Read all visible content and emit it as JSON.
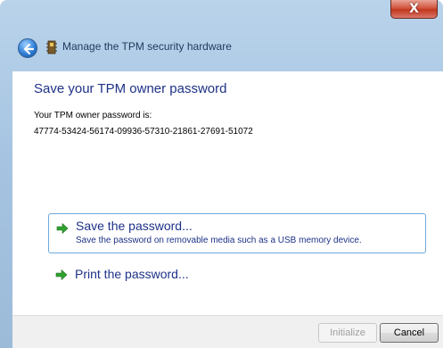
{
  "window": {
    "title": "Manage the TPM security hardware",
    "close_glyph": "X"
  },
  "page": {
    "heading": "Save your TPM owner password",
    "password_label": "Your TPM owner password is:",
    "password_value": "47774-53424-56174-09936-57310-21861-27691-51072"
  },
  "options": [
    {
      "title": "Save the password...",
      "description": "Save the password on removable media such as a USB memory device.",
      "icon": "green-arrow-icon",
      "selected": true
    },
    {
      "title": "Print the password...",
      "icon": "green-arrow-icon",
      "selected": false
    }
  ],
  "footer": {
    "initialize_label": "Initialize",
    "cancel_label": "Cancel"
  },
  "colors": {
    "link_text": "#1e3287",
    "arrow": "#2fa12f",
    "close_button": "#c2371e"
  }
}
